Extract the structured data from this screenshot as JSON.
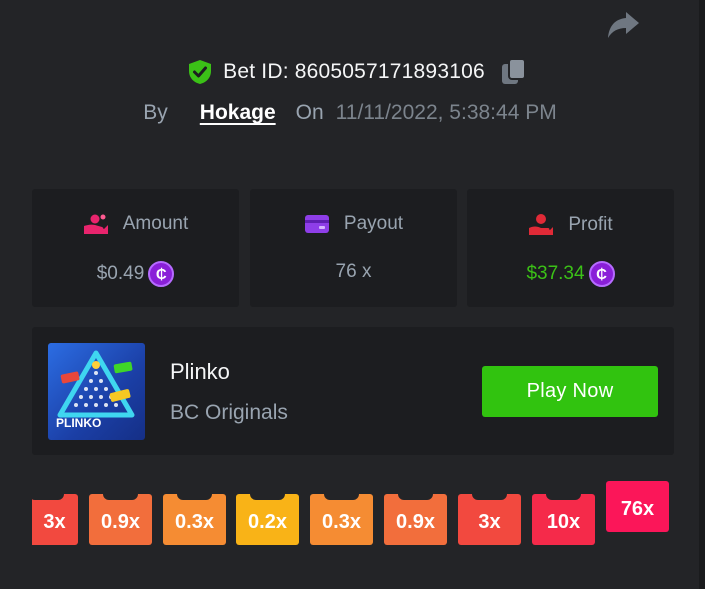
{
  "header": {
    "bet_label": "Bet ID: 8605057171893106",
    "by_label": "By",
    "username": "Hokage",
    "on_label": "On",
    "datetime": "11/11/2022, 5:38:44 PM"
  },
  "stats": {
    "amount": {
      "label": "Amount",
      "value": "$0.49",
      "coin": "₵"
    },
    "payout": {
      "label": "Payout",
      "value": "76 x"
    },
    "profit": {
      "label": "Profit",
      "value": "$37.34",
      "coin": "₵"
    }
  },
  "game": {
    "name": "Plinko",
    "provider": "BC Originals",
    "thumb_label": "PLINKO",
    "play_label": "Play Now"
  },
  "multipliers": {
    "items": [
      "3x",
      "0.9x",
      "0.3x",
      "0.2x",
      "0.3x",
      "0.9x",
      "3x",
      "10x",
      "76x"
    ],
    "hit": "76x"
  },
  "colors": {
    "background": "#232427",
    "card": "#1c1d20",
    "accent_green": "#31c30f",
    "profit_green": "#3bc117",
    "coin_purple": "#8a1fd8"
  },
  "icons": [
    "share-icon",
    "shield-check-icon",
    "copy-icon",
    "amount-icon",
    "payout-card-icon",
    "profit-icon",
    "coin-icon"
  ]
}
